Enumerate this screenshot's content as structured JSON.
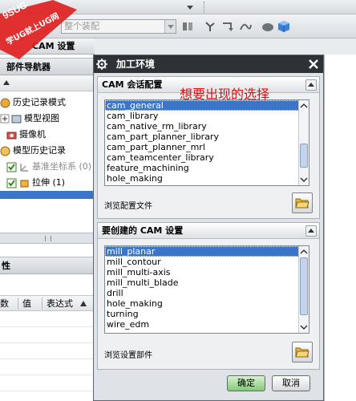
{
  "toolbar": {
    "filter_combo": "整个装配",
    "left_combo": ""
  },
  "app_title": "CAM 设置",
  "watermark": {
    "top": "9SUG",
    "bottom": "学UG就上UG网"
  },
  "navigator": {
    "title": "部件导航器",
    "items": [
      {
        "label": "历史记录模式",
        "dim": false
      },
      {
        "label": "模型视图",
        "dim": false
      },
      {
        "label": "摄像机",
        "dim": false
      },
      {
        "label": "模型历史记录",
        "dim": false
      },
      {
        "label": "基准坐标系 (0)",
        "dim": true
      },
      {
        "label": "拉伸 (1)",
        "dim": false
      }
    ],
    "properties_title": "性",
    "columns": [
      "数",
      "值",
      "表达式"
    ]
  },
  "dialog": {
    "title": "加工环境",
    "section1": {
      "title": "CAM 会话配置",
      "items": [
        "cam_general",
        "cam_library",
        "cam_native_rm_library",
        "cam_part_planner_library",
        "cam_part_planner_mrl",
        "cam_teamcenter_library",
        "feature_machining",
        "hole_making"
      ],
      "selected": 0,
      "browse_label": "浏览配置文件"
    },
    "section2": {
      "title": "要创建的 CAM 设置",
      "items": [
        "mill_planar",
        "mill_contour",
        "mill_multi-axis",
        "mill_multi_blade",
        "drill",
        "hole_making",
        "turning",
        "wire_edm"
      ],
      "selected": 0,
      "browse_label": "浏览设置部件"
    },
    "annotation": "想要出现的选择",
    "ok_label": "确定",
    "cancel_label": "取消"
  },
  "colors": {
    "selection": "#3a75c8",
    "dialog_title_bg": "#2e3236",
    "annotation": "#e01010",
    "ok_button": "#86c77b"
  }
}
